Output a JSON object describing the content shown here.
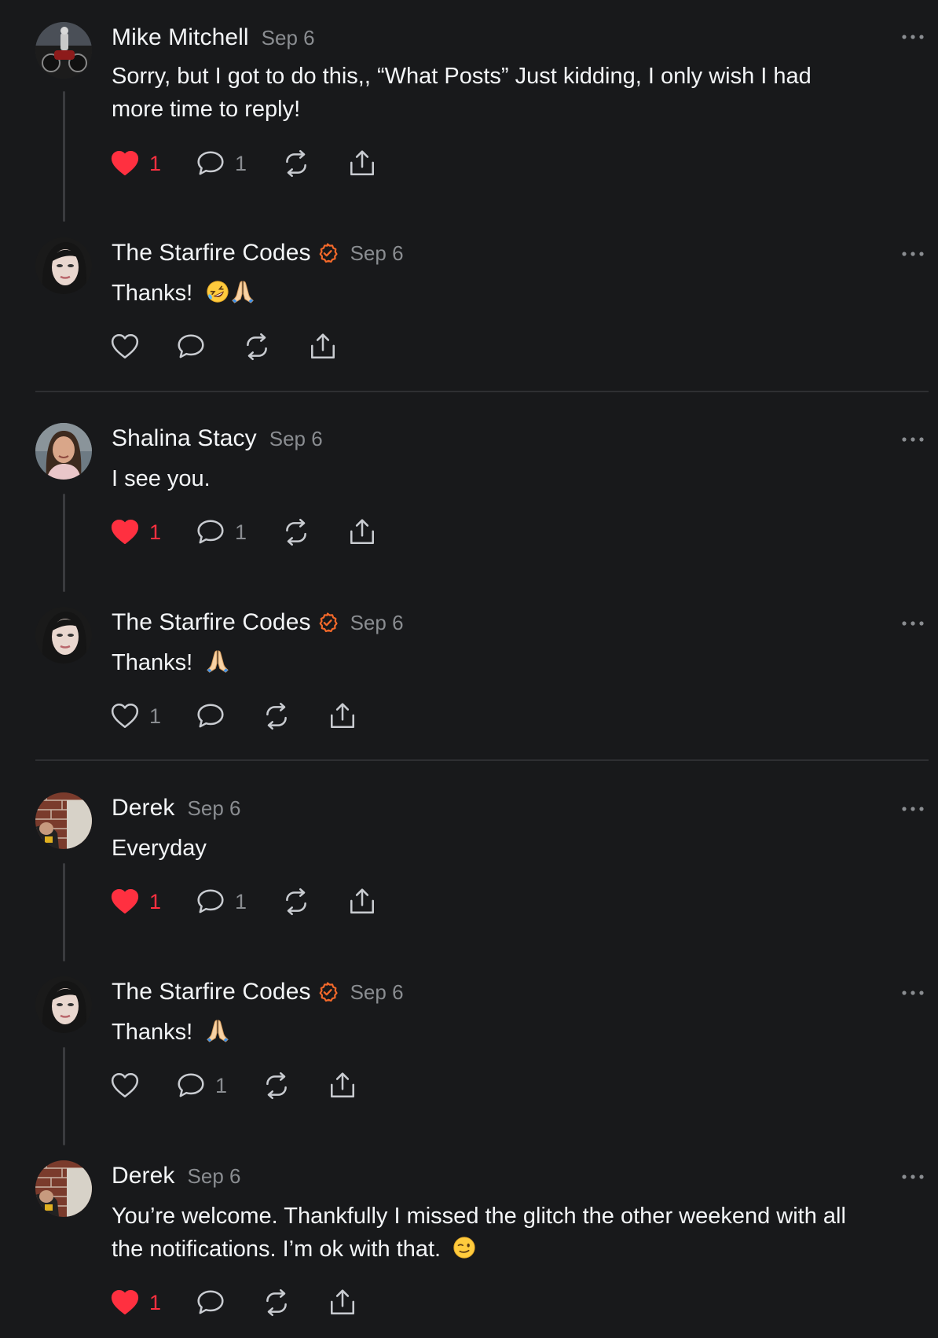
{
  "colors": {
    "background": "#18191b",
    "text": "#f3f5f7",
    "muted": "#8a8d91",
    "like_red": "#ff3040",
    "verified_orange": "#f4692a",
    "divider": "#2e2f32"
  },
  "posts": [
    {
      "author": "Mike Mitchell",
      "verified": false,
      "date": "Sep 6",
      "text_line1": "Sorry, but I got to do this,, “What Posts” Just kidding, I only wish I had",
      "text_line2": "more time to reply!",
      "liked": true,
      "like_count": "1",
      "reply_count": "1"
    },
    {
      "author": "The Starfire Codes",
      "verified": true,
      "date": "Sep 6",
      "text": "Thanks!",
      "emojis": [
        "rolling-on-floor-laughing",
        "folded-hands"
      ],
      "liked": false,
      "like_count": "",
      "reply_count": ""
    },
    {
      "author": "Shalina Stacy",
      "verified": false,
      "date": "Sep 6",
      "text": "I see you.",
      "liked": true,
      "like_count": "1",
      "reply_count": "1"
    },
    {
      "author": "The Starfire Codes",
      "verified": true,
      "date": "Sep 6",
      "text": "Thanks!",
      "emojis": [
        "folded-hands"
      ],
      "liked": false,
      "like_count": "1",
      "reply_count": ""
    },
    {
      "author": "Derek",
      "verified": false,
      "date": "Sep 6",
      "text": "Everyday",
      "liked": true,
      "like_count": "1",
      "reply_count": "1"
    },
    {
      "author": "The Starfire Codes",
      "verified": true,
      "date": "Sep 6",
      "text": "Thanks!",
      "emojis": [
        "folded-hands"
      ],
      "liked": false,
      "like_count": "",
      "reply_count": "1"
    },
    {
      "author": "Derek",
      "verified": false,
      "date": "Sep 6",
      "text_line1": "You’re welcome. Thankfully I missed the glitch the other weekend with all",
      "text_line2": "the notifications. I’m ok with that.",
      "emojis": [
        "winking-face"
      ],
      "liked": true,
      "like_count": "1",
      "reply_count": ""
    }
  ],
  "icons": {
    "like": "heart-icon",
    "reply": "comment-bubble-icon",
    "repost": "repost-icon",
    "share": "share-icon",
    "more": "more-options-icon",
    "verified": "verified-badge-icon"
  }
}
